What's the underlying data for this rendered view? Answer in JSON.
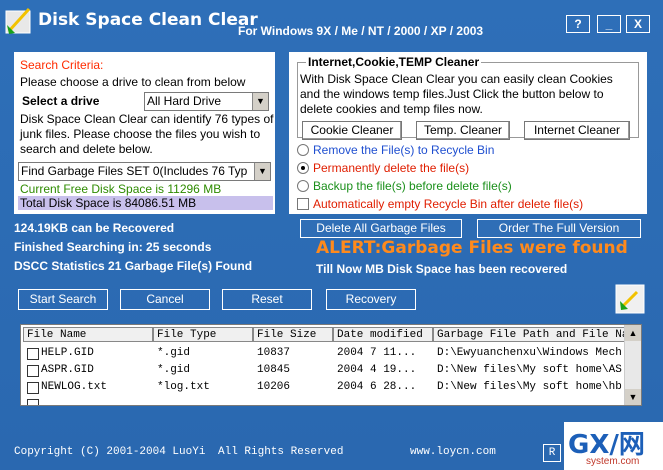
{
  "window": {
    "title": "Disk Space Clean Clear",
    "platforms": "For Windows 9X / Me / NT / 2000 / XP / 2003",
    "help_label": "?",
    "min_label": "_",
    "close_label": "X"
  },
  "criteria": {
    "heading": "Search Criteria:",
    "line1": "Please choose a drive to clean from below",
    "drive_label": "Select a drive",
    "drive_value": "All Hard Drive",
    "description": "Disk Space Clean Clear can identify 76 types of junk files. Please choose the files you wish to search and delete below.",
    "fileset_value": "Find Garbage Files SET 0(Includes 76 Typ",
    "free_space": "Current Free Disk Space is 11296 MB",
    "total_space": "Total Disk Space is 84086.51 MB"
  },
  "internet": {
    "legend": "Internet,Cookie,TEMP Cleaner",
    "text": "With Disk Space Clean Clear you can easily clean Cookies and the windows temp files.Just Click the button below to delete cookies and temp files now.",
    "cookie_btn": "Cookie Cleaner",
    "temp_btn": "Temp. Cleaner",
    "inet_btn": "Internet Cleaner",
    "opt_recycle": "Remove the File(s) to Recycle Bin",
    "opt_delete": "Permanently delete the file(s)",
    "opt_backup": "Backup the file(s) before delete file(s)",
    "opt_empty": "Automatically empty Recycle Bin after delete file(s)"
  },
  "status": {
    "recover": "124.19KB can be Recovered",
    "finished": "Finished Searching in: 25 seconds",
    "stats": "DSCC Statistics 21 Garbage File(s) Found",
    "alert": "ALERT:Garbage Files were found",
    "till_now": "Till Now MB Disk Space has been recovered"
  },
  "actions": {
    "delete_all": "Delete All Garbage Files",
    "order": "Order The Full Version",
    "start": "Start Search",
    "cancel": "Cancel",
    "reset": "Reset",
    "recovery": "Recovery"
  },
  "table": {
    "headers": [
      "File Name",
      "File Type",
      "File Size",
      "Date modified",
      "Garbage File Path and File Name"
    ],
    "rows": [
      [
        "HELP.GID",
        "*.gid",
        "10837",
        "2004  7  11...",
        "D:\\Ewyuanchenxu\\Windows Mech..."
      ],
      [
        "ASPR.GID",
        "*.gid",
        "10845",
        "2004  4  19...",
        "D:\\New files\\My soft home\\AS..."
      ],
      [
        "NEWLOG.txt",
        "*log.txt",
        "10206",
        "2004  6  28...",
        "D:\\New files\\My soft home\\hb..."
      ]
    ]
  },
  "footer": {
    "copyright": "Copyright (C) 2001-2004 LuoYi",
    "rights": "All Rights Reserved",
    "site": "www.loycn.com",
    "r_label": "R"
  },
  "watermark": {
    "gxi": "GX/网",
    "site": "system.com"
  },
  "colors": {
    "background": "#2f6eb6",
    "alert": "#ff8a1c",
    "heading_red": "#ff2b00",
    "green": "#2e8b00"
  }
}
